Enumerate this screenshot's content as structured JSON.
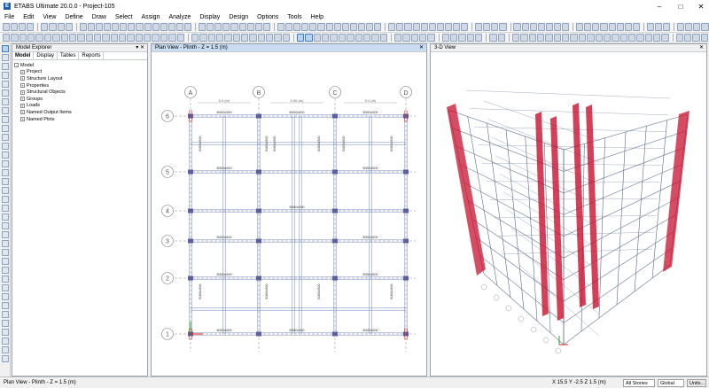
{
  "window": {
    "title": "ETABS Ultimate 20.0.0 - Project-105",
    "app_badge": "E"
  },
  "menu": [
    "File",
    "Edit",
    "View",
    "Define",
    "Draw",
    "Select",
    "Assign",
    "Analyze",
    "Display",
    "Design",
    "Options",
    "Tools",
    "Help"
  ],
  "explorer": {
    "title": "Model Explorer",
    "tabs": [
      "Model",
      "Display",
      "Tables",
      "Reports"
    ],
    "tree_root": "Model",
    "tree_items": [
      "Project",
      "Structure Layout",
      "Properties",
      "Structural Objects",
      "Groups",
      "Loads",
      "Named Output Items",
      "Named Plots"
    ]
  },
  "plan_view": {
    "title": "Plan View - Plinth - Z = 1.5 (m)",
    "column_grids": [
      "A",
      "B",
      "C",
      "D"
    ],
    "row_grids": [
      "6",
      "5",
      "4",
      "3",
      "2",
      "1"
    ],
    "spacings_top": [
      "5.4 (m)",
      "5.55 (m)",
      "5.4 (m)"
    ],
    "beam_label": "B300x500"
  },
  "view3d": {
    "title": "3-D View"
  },
  "status": {
    "left": "Plan View - Plinth - Z = 1.5 (m)",
    "coords": "X 15.5  Y -2.5  Z 1.5 (m)",
    "stories": "All Stories",
    "coord_sys": "Global",
    "units_btn": "Units..."
  },
  "colors": {
    "accent": "#1f5fa8",
    "beam": "#6b7fb5",
    "column_fill": "#c8102e",
    "grid": "#8c8c8c"
  }
}
